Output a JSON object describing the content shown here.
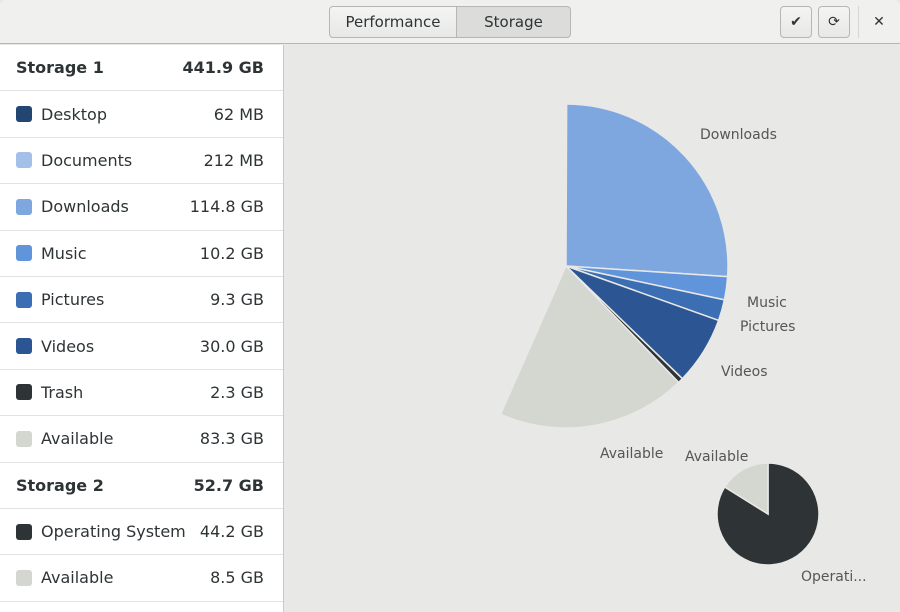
{
  "header": {
    "tabs": [
      {
        "label": "Performance",
        "active": false
      },
      {
        "label": "Storage",
        "active": true
      }
    ],
    "buttons": {
      "apply": "✔",
      "refresh": "⟳",
      "close": "✕"
    }
  },
  "sidebar": {
    "groups": [
      {
        "title": "Storage 1",
        "total": "441.9 GB",
        "items": [
          {
            "label": "Desktop",
            "size": "62 MB",
            "color": "#234571"
          },
          {
            "label": "Documents",
            "size": "212 MB",
            "color": "#a3c0e9"
          },
          {
            "label": "Downloads",
            "size": "114.8 GB",
            "color": "#7ea7e0"
          },
          {
            "label": "Music",
            "size": "10.2 GB",
            "color": "#6094db"
          },
          {
            "label": "Pictures",
            "size": "9.3 GB",
            "color": "#3c6eb4"
          },
          {
            "label": "Videos",
            "size": "30.0 GB",
            "color": "#2c5693"
          },
          {
            "label": "Trash",
            "size": "2.3 GB",
            "color": "#2e3436"
          },
          {
            "label": "Available",
            "size": "83.3 GB",
            "color": "#d3d7cf"
          }
        ]
      },
      {
        "title": "Storage 2",
        "total": "52.7 GB",
        "items": [
          {
            "label": "Operating System",
            "size": "44.2 GB",
            "color": "#2e3436"
          },
          {
            "label": "Available",
            "size": "8.5 GB",
            "color": "#d3d7cf"
          }
        ]
      }
    ]
  },
  "chart_data": [
    {
      "type": "pie",
      "title": "Storage 1",
      "total_gb": 441.9,
      "slices": [
        {
          "label": "Desktop",
          "value_gb": 0.062,
          "color": "#234571",
          "labeled": false
        },
        {
          "label": "Documents",
          "value_gb": 0.212,
          "color": "#a3c0e9",
          "labeled": false
        },
        {
          "label": "Downloads",
          "value_gb": 114.8,
          "color": "#7ea7e0",
          "labeled": true
        },
        {
          "label": "Music",
          "value_gb": 10.2,
          "color": "#6094db",
          "labeled": true
        },
        {
          "label": "Pictures",
          "value_gb": 9.3,
          "color": "#3c6eb4",
          "labeled": true
        },
        {
          "label": "Videos",
          "value_gb": 30.0,
          "color": "#2c5693",
          "labeled": true
        },
        {
          "label": "Trash",
          "value_gb": 2.3,
          "color": "#2e3436",
          "labeled": false
        },
        {
          "label": "Available",
          "value_gb": 83.3,
          "color": "#d3d7cf",
          "labeled": true
        }
      ]
    },
    {
      "type": "pie",
      "title": "Storage 2",
      "total_gb": 52.7,
      "slices": [
        {
          "label": "Operating System",
          "display_label": "Operati...",
          "value_gb": 44.2,
          "color": "#2e3436",
          "labeled": true
        },
        {
          "label": "Available",
          "value_gb": 8.5,
          "color": "#d3d7cf",
          "labeled": true
        }
      ]
    }
  ]
}
